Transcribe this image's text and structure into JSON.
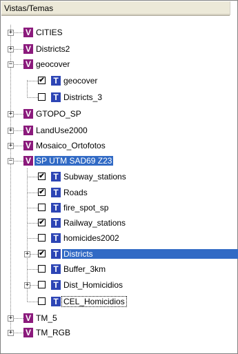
{
  "header": {
    "title": "Vistas/Temas"
  },
  "views": [
    {
      "label": "CITIES",
      "badge": "V",
      "expander": "+"
    },
    {
      "label": "Districts2",
      "badge": "V",
      "expander": "+"
    },
    {
      "label": "geocover",
      "badge": "V",
      "expander": "−",
      "themes": [
        {
          "label": "geocover",
          "badge": "T",
          "checked": "✔"
        },
        {
          "label": "Districts_3",
          "badge": "T",
          "checked": ""
        }
      ]
    },
    {
      "label": "GTOPO_SP",
      "badge": "V",
      "expander": "+"
    },
    {
      "label": "LandUse2000",
      "badge": "V",
      "expander": "+"
    },
    {
      "label": "Mosaico_Ortofotos",
      "badge": "V",
      "expander": "+"
    },
    {
      "label": "SP UTM SAD69 Z23",
      "badge": "V",
      "expander": "−",
      "selected": true,
      "themes": [
        {
          "label": "Subway_stations",
          "badge": "T",
          "checked": "✔"
        },
        {
          "label": "Roads",
          "badge": "T",
          "checked": "✔"
        },
        {
          "label": "fire_spot_sp",
          "badge": "T",
          "checked": ""
        },
        {
          "label": "Railway_stations",
          "badge": "T",
          "checked": "✔"
        },
        {
          "label": "homicides2002",
          "badge": "T",
          "checked": ""
        },
        {
          "label": "Districts",
          "badge": "T",
          "checked": "✔",
          "expander": "+",
          "selected": true
        },
        {
          "label": "Buffer_3km",
          "badge": "T",
          "checked": ""
        },
        {
          "label": "Dist_Homicidios",
          "badge": "T",
          "checked": "",
          "expander": "+"
        },
        {
          "label": "CEL_Homicidios",
          "badge": "T",
          "checked": ""
        }
      ]
    },
    {
      "label": "TM_5",
      "badge": "V",
      "expander": "+"
    },
    {
      "label": "TM_RGB",
      "badge": "V",
      "expander": "+"
    }
  ]
}
